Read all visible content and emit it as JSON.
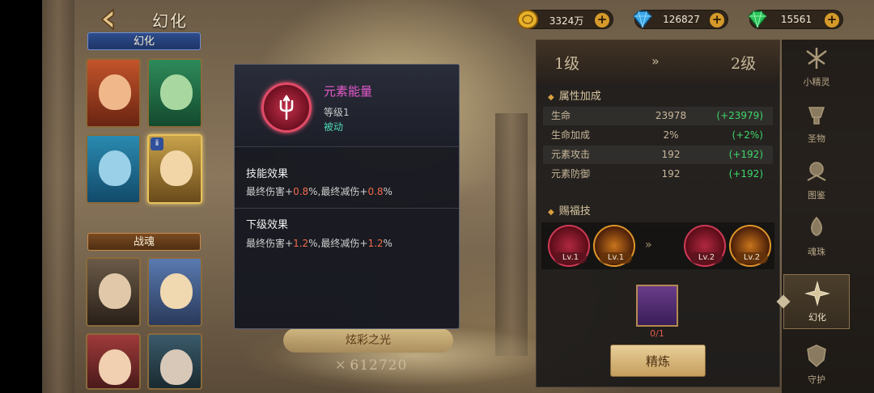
{
  "header": {
    "title": "幻化",
    "back_icon": "back-arrow-icon"
  },
  "currencies": [
    {
      "name": "gold",
      "icon": "gold-coin-icon",
      "value": "3324万",
      "plus": "+"
    },
    {
      "name": "blue-diamond",
      "icon": "blue-diamond-icon",
      "value": "126827",
      "plus": "+"
    },
    {
      "name": "green-gem",
      "icon": "green-gem-icon",
      "value": "15561",
      "plus": "+"
    }
  ],
  "left_list": {
    "section1": "幻化",
    "section2": "战魂"
  },
  "skill_popup": {
    "name": "元素能量",
    "level": "等级1",
    "type": "被动",
    "effect_title": "技能效果",
    "effect_line": {
      "a": "最终伤害+",
      "v1": "0.8",
      "b": "%,最终减伤+",
      "v2": "0.8",
      "c": "%"
    },
    "next_title": "下级效果",
    "next_line": {
      "a": "最终伤害+",
      "v1": "1.2",
      "b": "%,最终减伤+",
      "v2": "1.2",
      "c": "%"
    }
  },
  "hero": {
    "name": "炫彩之光",
    "power_prefix": "✕",
    "power": "612720"
  },
  "right_panel": {
    "level_from": "1级",
    "level_arrow": "»",
    "level_to": "2级",
    "attr_title": "属性加成",
    "attributes": [
      {
        "name": "生命",
        "value": "23978",
        "delta": "(+23979)"
      },
      {
        "name": "生命加成",
        "value": "2%",
        "delta": "(+2%)"
      },
      {
        "name": "元素攻击",
        "value": "192",
        "delta": "(+192)"
      },
      {
        "name": "元素防御",
        "value": "192",
        "delta": "(+192)"
      }
    ],
    "bless_title": "赐福技",
    "bless_before": [
      {
        "level": "Lv.1"
      },
      {
        "level": "Lv.1"
      }
    ],
    "bless_arrow": "»",
    "bless_after": [
      {
        "level": "Lv.2"
      },
      {
        "level": "Lv.2"
      }
    ],
    "material_count": "0/1",
    "refine_label": "精炼"
  },
  "side_nav": [
    {
      "label": "小精灵",
      "icon": "fairy-icon"
    },
    {
      "label": "圣物",
      "icon": "relic-icon"
    },
    {
      "label": "图鉴",
      "icon": "codex-icon"
    },
    {
      "label": "魂珠",
      "icon": "soul-orb-icon"
    },
    {
      "label": "幻化",
      "icon": "transform-icon",
      "active": true
    },
    {
      "label": "守护",
      "icon": "guardian-icon"
    }
  ]
}
